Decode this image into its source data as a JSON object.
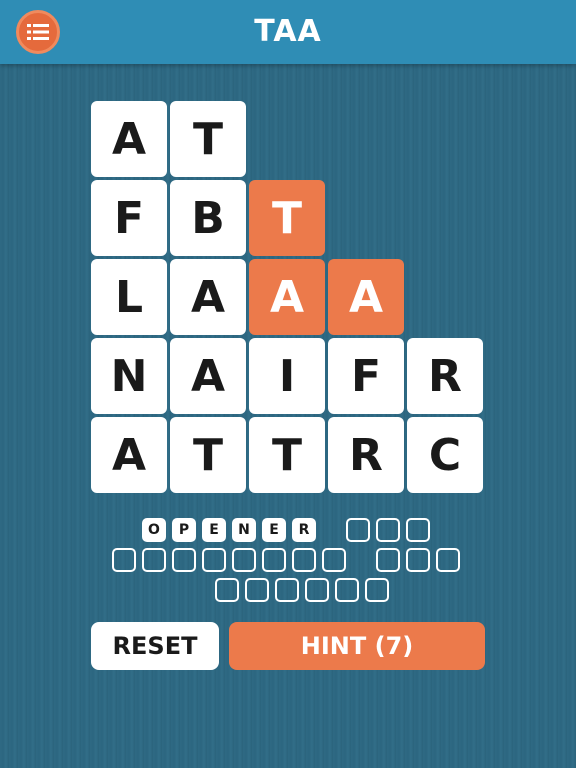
{
  "header": {
    "title": "TAA",
    "menu_icon": "list-icon",
    "accent_color": "#2f8db5"
  },
  "board": {
    "rows": [
      [
        {
          "letter": "A",
          "state": "normal"
        },
        {
          "letter": "T",
          "state": "normal"
        },
        {
          "letter": "",
          "state": "empty"
        },
        {
          "letter": "",
          "state": "empty"
        },
        {
          "letter": "",
          "state": "empty"
        }
      ],
      [
        {
          "letter": "F",
          "state": "normal"
        },
        {
          "letter": "B",
          "state": "normal"
        },
        {
          "letter": "T",
          "state": "selected"
        },
        {
          "letter": "",
          "state": "empty"
        },
        {
          "letter": "",
          "state": "empty"
        }
      ],
      [
        {
          "letter": "L",
          "state": "normal"
        },
        {
          "letter": "A",
          "state": "normal"
        },
        {
          "letter": "A",
          "state": "selected"
        },
        {
          "letter": "A",
          "state": "selected"
        },
        {
          "letter": "",
          "state": "empty"
        }
      ],
      [
        {
          "letter": "N",
          "state": "normal"
        },
        {
          "letter": "A",
          "state": "normal"
        },
        {
          "letter": "I",
          "state": "normal"
        },
        {
          "letter": "F",
          "state": "normal"
        },
        {
          "letter": "R",
          "state": "normal"
        }
      ],
      [
        {
          "letter": "A",
          "state": "normal"
        },
        {
          "letter": "T",
          "state": "normal"
        },
        {
          "letter": "T",
          "state": "normal"
        },
        {
          "letter": "R",
          "state": "normal"
        },
        {
          "letter": "C",
          "state": "normal"
        }
      ]
    ]
  },
  "words": {
    "lines": [
      [
        {
          "letters": [
            "O",
            "P",
            "E",
            "N",
            "E",
            "R"
          ]
        },
        {
          "letters": [
            "",
            "",
            ""
          ]
        }
      ],
      [
        {
          "letters": [
            "",
            "",
            "",
            "",
            "",
            "",
            "",
            ""
          ]
        },
        {
          "letters": [
            "",
            "",
            ""
          ]
        }
      ],
      [
        {
          "letters": [
            "",
            "",
            "",
            "",
            "",
            ""
          ]
        }
      ]
    ]
  },
  "buttons": {
    "reset_label": "RESET",
    "hint_label": "HINT (7)"
  },
  "colors": {
    "selected_tile": "#ec7a4b",
    "tile": "#ffffff",
    "background": "#2f6a84"
  }
}
